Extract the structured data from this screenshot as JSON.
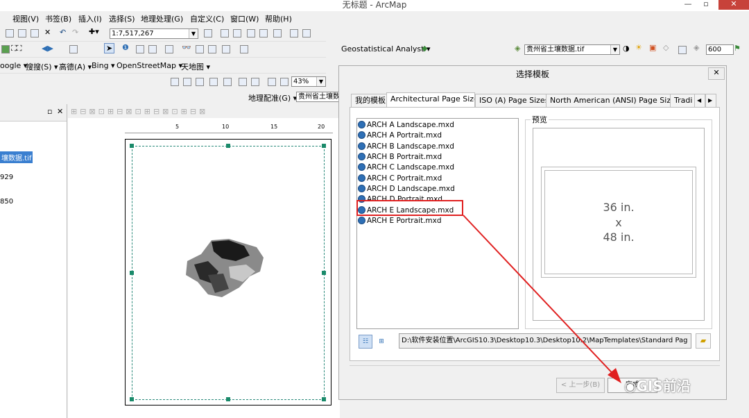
{
  "window": {
    "title": "无标题 - ArcMap"
  },
  "menu": [
    "视图(V)",
    "书签(B)",
    "插入(I)",
    "选择(S)",
    "地理处理(G)",
    "自定义(C)",
    "窗口(W)",
    "帮助(H)"
  ],
  "toolbar1": {
    "scale": "1:7,517,267"
  },
  "toolbar2": {
    "geostat": "Geostatistical Analyst ▾",
    "layer": "贵州省土壤数据.tif",
    "value": "600"
  },
  "toolbar3": {
    "items": [
      "oogle ▾",
      "搜搜(S) ▾",
      "高德(A) ▾",
      "Bing ▾",
      "OpenStreetMap ▾",
      "天地图 ▾"
    ]
  },
  "layout_toolbar": {
    "zoom": "43%"
  },
  "georef": {
    "label": "地理配准(G) ▾",
    "layer": "贵州省土壤数"
  },
  "toc": {
    "items": [
      "壤数据.tif",
      "929",
      "850"
    ]
  },
  "ruler": {
    "ticks": [
      "5",
      "10",
      "15",
      "20"
    ]
  },
  "dialog": {
    "title": "选择模板",
    "close": "✕",
    "tabs": [
      "我的模板",
      "Architectural Page Sizes",
      "ISO (A) Page Sizes",
      "North American (ANSI) Page Sizes",
      "Tradi"
    ],
    "files": [
      "ARCH A Landscape.mxd",
      "ARCH A Portrait.mxd",
      "ARCH B Landscape.mxd",
      "ARCH B Portrait.mxd",
      "ARCH C Landscape.mxd",
      "ARCH C Portrait.mxd",
      "ARCH D Landscape.mxd",
      "ARCH D Portrait.mxd",
      "ARCH E Landscape.mxd",
      "ARCH E Portrait.mxd"
    ],
    "selected_index": 8,
    "preview_label": "预览",
    "preview": {
      "w": "36 in.",
      "x": "x",
      "h": "48 in."
    },
    "path": "D:\\软件安装位置\\ArcGIS10.3\\Desktop10.3\\Desktop10.2\\MapTemplates\\Standard Pag",
    "back": "< 上一步(B)",
    "next": "完成"
  },
  "watermark": "GIS前沿",
  "colors": {
    "highlight": "#e02020",
    "arrow": "#e02020",
    "selection_frame": "#2a8a7a"
  }
}
